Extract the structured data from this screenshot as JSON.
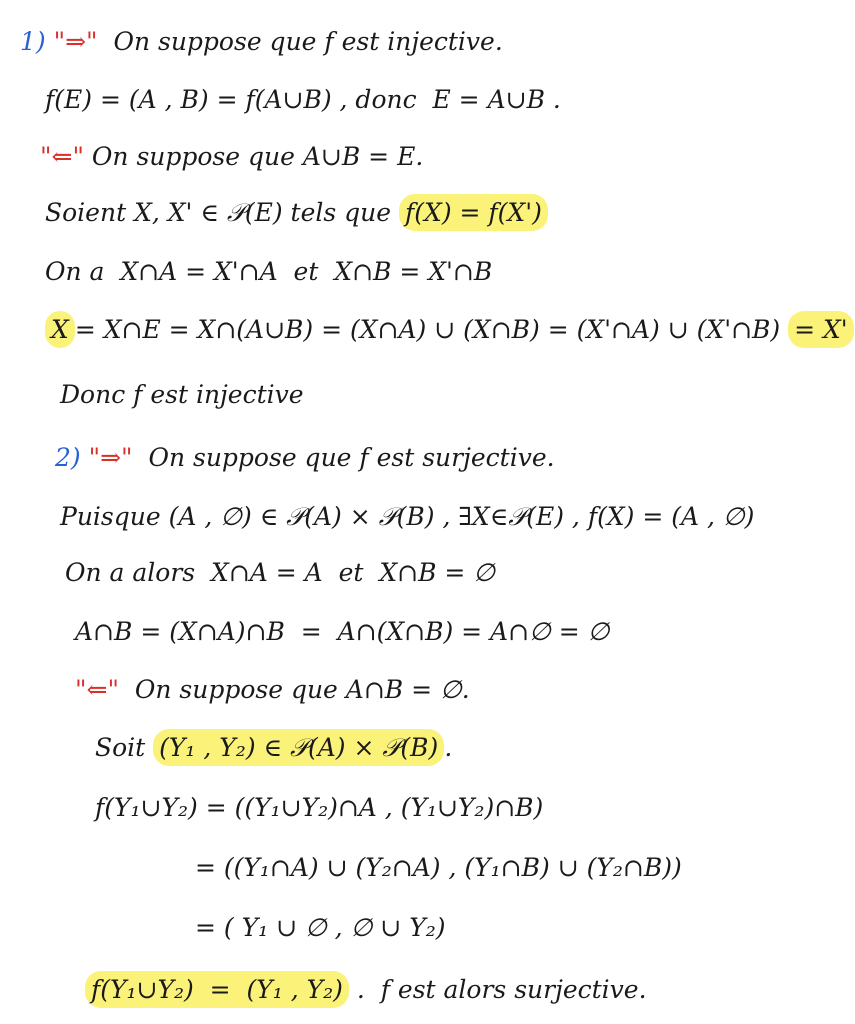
{
  "colors": {
    "ink": "#1a1a1a",
    "blue": "#2a62d6",
    "red": "#d9302a",
    "highlight": "#fbf27a"
  },
  "lines": [
    {
      "segments": [
        {
          "text": "1) ",
          "color": "#2a62d6"
        },
        {
          "text": "\"⇒\"",
          "color": "#d9302a"
        },
        {
          "text": "  On suppose que f est injective."
        }
      ]
    },
    {
      "segments": [
        {
          "text": "f(E) = (A , B) = f(A∪B) , donc  E = A∪B ."
        }
      ]
    },
    {
      "segments": [
        {
          "text": "\"⇐\"",
          "color": "#d9302a"
        },
        {
          "text": " On suppose que A∪B = E."
        }
      ]
    },
    {
      "segments": [
        {
          "text": "Soient X, X' ∈ 𝒫(E) tels que "
        },
        {
          "text": "f(X) = f(X')",
          "highlight": true
        }
      ]
    },
    {
      "segments": [
        {
          "text": "On a  X∩A = X'∩A  et  X∩B = X'∩B"
        }
      ]
    },
    {
      "segments": [
        {
          "text": "X",
          "highlight": true
        },
        {
          "text": "= X∩E = X∩(A∪B) = (X∩A) ∪ (X∩B) = (X'∩A) ∪ (X'∩B) "
        },
        {
          "text": "= X'",
          "highlight": true
        }
      ]
    },
    {
      "segments": [
        {
          "text": "Donc f est injective"
        }
      ]
    },
    {
      "segments": [
        {
          "text": "2) ",
          "color": "#2a62d6"
        },
        {
          "text": "\"⇒\"",
          "color": "#d9302a"
        },
        {
          "text": "  On suppose que f est surjective."
        }
      ]
    },
    {
      "segments": [
        {
          "text": "Puisque (A , ∅) ∈ 𝒫(A) × 𝒫(B) , ∃X∈𝒫(E) , f(X) = (A , ∅)"
        }
      ]
    },
    {
      "segments": [
        {
          "text": "On a alors  X∩A = A  et  X∩B = ∅"
        }
      ]
    },
    {
      "segments": [
        {
          "text": "A∩B = (X∩A)∩B  =  A∩(X∩B) = A∩∅ = ∅"
        }
      ]
    },
    {
      "segments": [
        {
          "text": "\"⇐\"",
          "color": "#d9302a"
        },
        {
          "text": "  On suppose que A∩B = ∅."
        }
      ]
    },
    {
      "segments": [
        {
          "text": "Soit "
        },
        {
          "text": "(Y₁ , Y₂) ∈ 𝒫(A) × 𝒫(B)",
          "highlight": true
        },
        {
          "text": "."
        }
      ]
    },
    {
      "segments": [
        {
          "text": "f(Y₁∪Y₂) = ((Y₁∪Y₂)∩A , (Y₁∪Y₂)∩B)"
        }
      ]
    },
    {
      "segments": [
        {
          "text": "= ((Y₁∩A) ∪ (Y₂∩A) , (Y₁∩B) ∪ (Y₂∩B))"
        }
      ]
    },
    {
      "segments": [
        {
          "text": "= ( Y₁ ∪ ∅ , ∅ ∪ Y₂)"
        }
      ]
    },
    {
      "segments": [
        {
          "text": "f(Y₁∪Y₂)  =  (Y₁ , Y₂)",
          "highlight": true
        },
        {
          "text": " .  f est alors surjective."
        }
      ]
    }
  ]
}
